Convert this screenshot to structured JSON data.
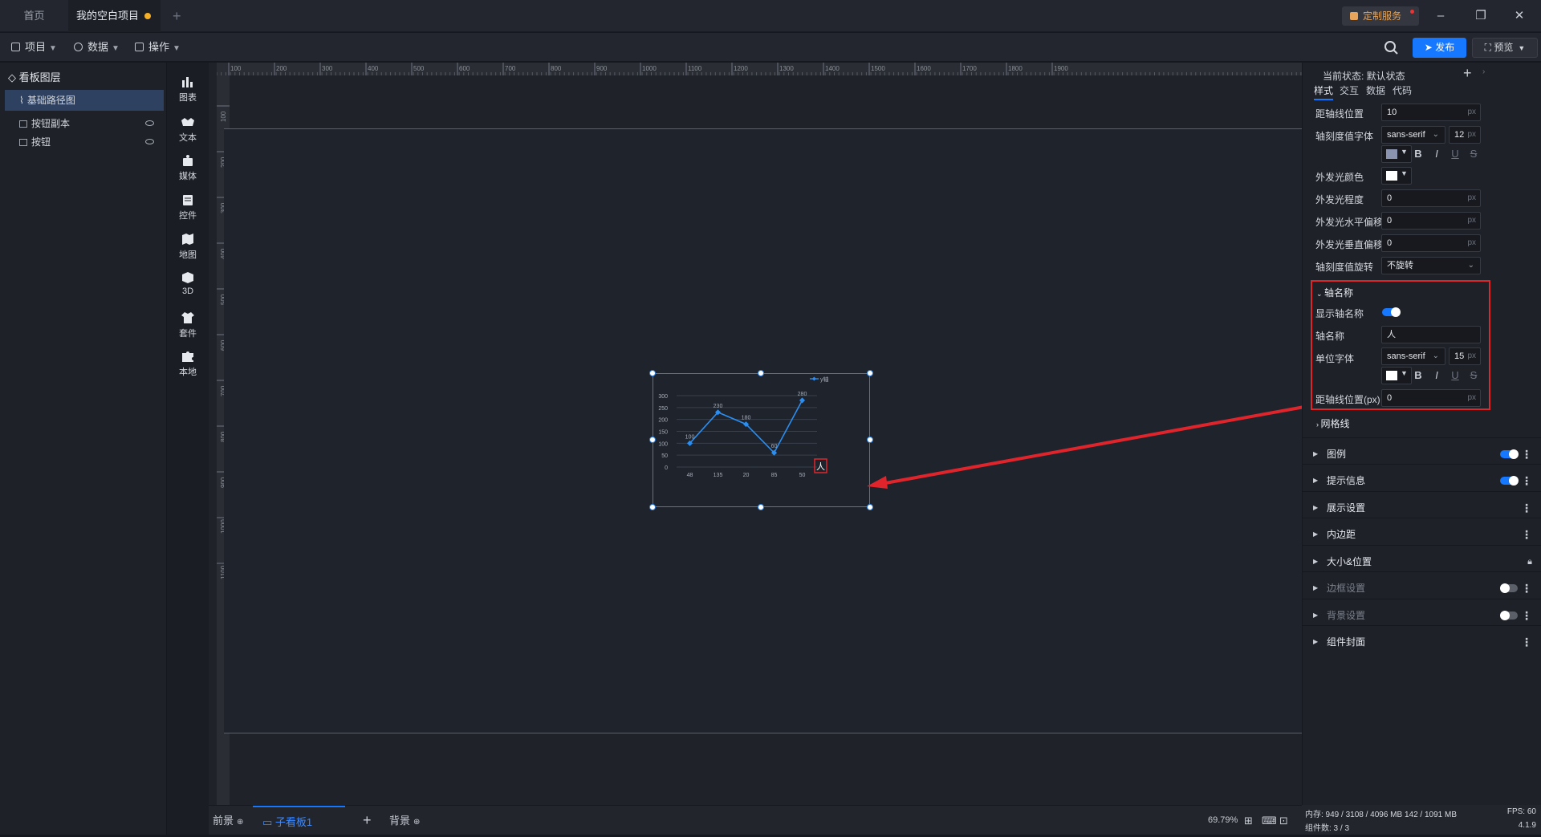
{
  "tabs": {
    "home": "首页",
    "project": "我的空白项目"
  },
  "custom_service": "定制服务",
  "menus": [
    {
      "label": "项目"
    },
    {
      "label": "数据"
    },
    {
      "label": "操作"
    }
  ],
  "publish": "发布",
  "preview": "预览",
  "layers": {
    "title": "看板图层",
    "items": [
      {
        "label": "基础路径图"
      },
      {
        "label": "按钮副本"
      },
      {
        "label": "按钮"
      }
    ]
  },
  "components": [
    "图表",
    "文本",
    "媒体",
    "控件",
    "地图",
    "3D",
    "套件",
    "本地"
  ],
  "ruler_top": [
    "100",
    "200",
    "300",
    "400",
    "500",
    "600",
    "700",
    "800",
    "900",
    "1000",
    "1100",
    "1200",
    "1300",
    "1400",
    "1500",
    "1600",
    "1700",
    "1800",
    "1900"
  ],
  "ruler_left": [
    "100",
    "200",
    "300",
    "400",
    "500",
    "600",
    "700",
    "800",
    "900",
    "1000",
    "1100"
  ],
  "chart_data": {
    "type": "line",
    "categories": [
      "48",
      "135",
      "20",
      "85",
      "50"
    ],
    "series": [
      {
        "name": "y轴",
        "values": [
          100,
          230,
          180,
          60,
          280
        ]
      }
    ],
    "y_ticks": [
      "300",
      "250",
      "200",
      "150",
      "100",
      "50",
      "0"
    ],
    "ylim": [
      0,
      300
    ],
    "axis_name": "人",
    "color": "#2b8ef0"
  },
  "bottom": {
    "front": "前景",
    "sub": "子看板1",
    "back": "背景",
    "zoom": "69.79%"
  },
  "props": {
    "state_label": "当前状态: 默认状态",
    "tabs": [
      "样式",
      "交互",
      "数据",
      "代码"
    ],
    "rows": {
      "axis_line_pos": {
        "label": "距轴线位置",
        "value": "10",
        "unit": "px"
      },
      "tick_font": {
        "label": "轴刻度值字体",
        "font": "sans-serif",
        "size": "12",
        "unit": "px"
      },
      "glow_color": {
        "label": "外发光颜色"
      },
      "glow_level": {
        "label": "外发光程度",
        "value": "0",
        "unit": "px"
      },
      "glow_h": {
        "label": "外发光水平偏移",
        "value": "0",
        "unit": "px"
      },
      "glow_v": {
        "label": "外发光垂直偏移",
        "value": "0",
        "unit": "px"
      },
      "tick_rotate": {
        "label": "轴刻度值旋转",
        "value": "不旋转"
      }
    },
    "axis_name_section": {
      "title": "轴名称",
      "show_label": "显示轴名称",
      "name_label": "轴名称",
      "name_value": "人",
      "font_label": "单位字体",
      "font": "sans-serif",
      "size": "15",
      "unit": "px",
      "pos_label": "距轴线位置(px)",
      "pos_value": "0",
      "pos_unit": "px"
    },
    "grid": "网格线",
    "sections": [
      "图例",
      "提示信息",
      "展示设置",
      "内边距",
      "大小&位置",
      "边框设置",
      "背景设置",
      "组件封面"
    ],
    "colors": {
      "tick_color": "#8a94b0",
      "white": "#ffffff",
      "accent": "#1677ff",
      "highlight": "#e0242c"
    }
  },
  "status": {
    "mem": "内存: 949 / 3108 / 4096 MB 142 / 1091 MB",
    "fps": "FPS: 60",
    "count": "组件数: 3 / 3",
    "version": "4.1.9"
  }
}
